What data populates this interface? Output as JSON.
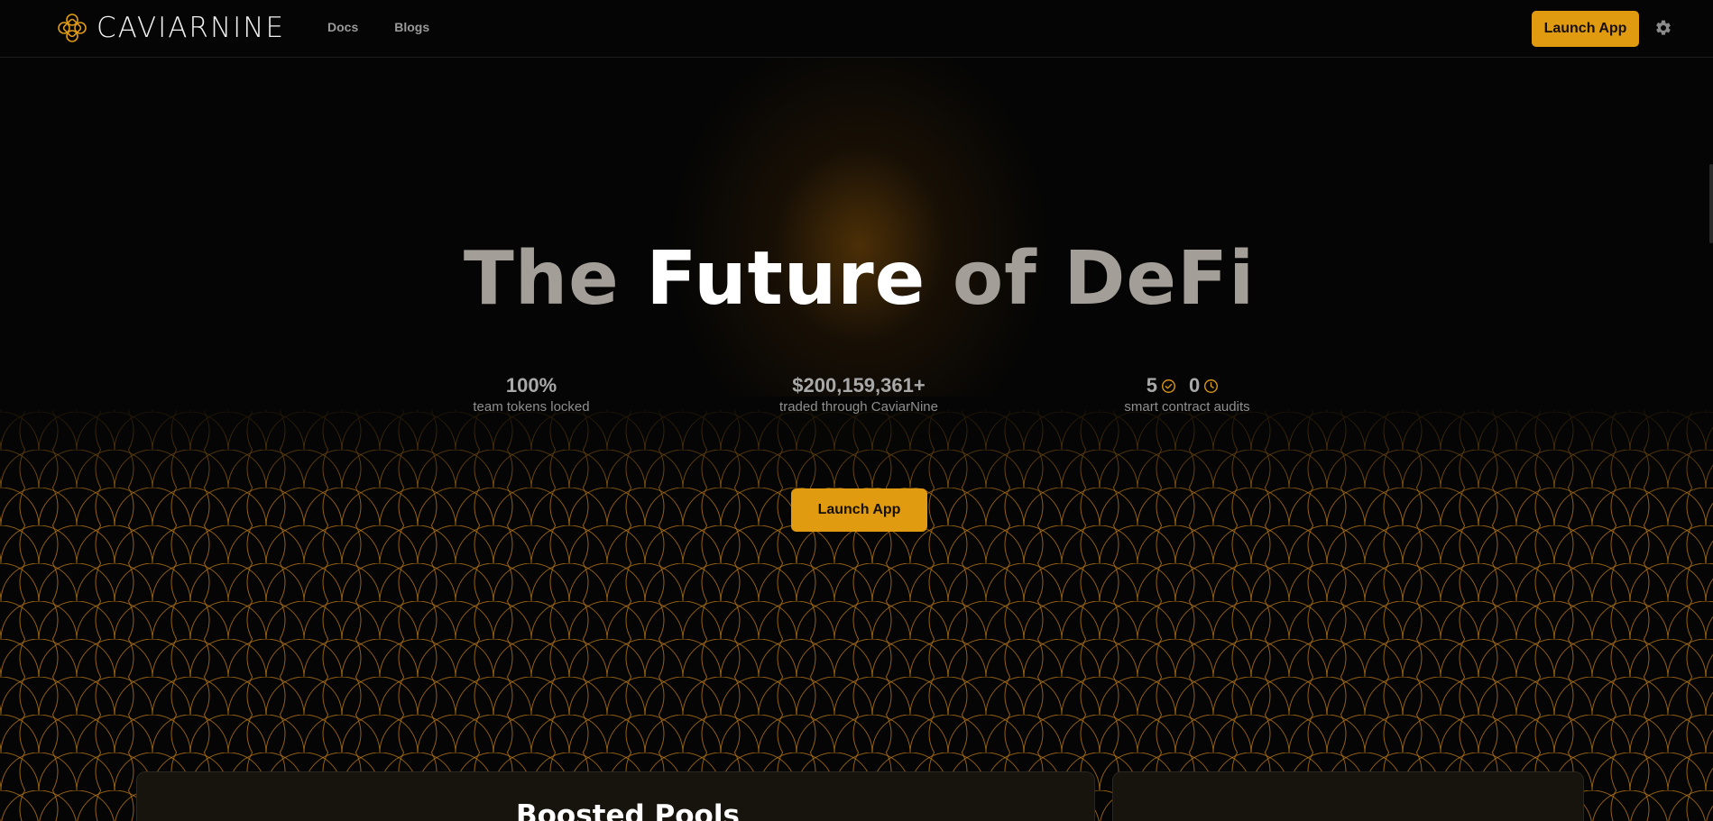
{
  "header": {
    "brand": "CAVIARNINE",
    "nav": [
      "Docs",
      "Blogs"
    ],
    "launch_label": "Launch App",
    "settings_icon": "gear-icon"
  },
  "hero": {
    "title_part1": "The",
    "title_part2": "Future",
    "title_part3": "of DeFi",
    "launch_label": "Launch App"
  },
  "stats": [
    {
      "value": "100%",
      "label": "team tokens locked"
    },
    {
      "value": "$200,159,361+",
      "label": "traded through CaviarNine"
    },
    {
      "value_completed": "5",
      "value_pending": "0",
      "label": "smart contract audits",
      "icons": [
        "check-circle-icon",
        "clock-icon"
      ]
    }
  ],
  "sections": {
    "boosted_pools_title": "Boosted Pools"
  },
  "colors": {
    "accent": "#e09b10",
    "background": "#050505",
    "pattern_stroke": "#c27d14"
  }
}
